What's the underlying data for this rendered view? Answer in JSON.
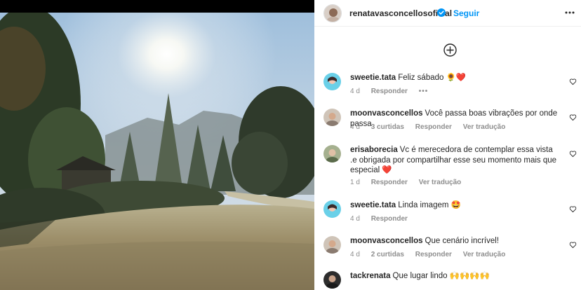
{
  "post": {
    "username": "renatavasconcellosoficial",
    "follow_label": "Seguir",
    "colors": {
      "accent": "#0095f6",
      "heart_red": "#ed4956",
      "text": "#262626",
      "muted": "#8e8e8e"
    }
  },
  "comments": [
    {
      "user": "sweetie.tata",
      "text": "Feliz sábado 🌻❤️",
      "time": "4 d",
      "likes": "",
      "reply": "Responder",
      "translate": "",
      "extra": "•••"
    },
    {
      "user": "moonvasconcellos",
      "text": "Você passa boas vibrações por onde passa",
      "time": "4 d",
      "likes": "3 curtidas",
      "reply": "Responder",
      "translate": "Ver tradução",
      "extra": ""
    },
    {
      "user": "erisaborecia",
      "text": "Vc é merecedora de contemplar essa vista .e obrigada por compartilhar esse seu momento mais que especial ❤️",
      "time": "1 d",
      "likes": "",
      "reply": "Responder",
      "translate": "Ver tradução",
      "extra": ""
    },
    {
      "user": "sweetie.tata",
      "text": "Linda imagem 🤩",
      "time": "4 d",
      "likes": "",
      "reply": "Responder",
      "translate": "",
      "extra": ""
    },
    {
      "user": "moonvasconcellos",
      "text": "Que cenário incrível!",
      "time": "4 d",
      "likes": "2 curtidas",
      "reply": "Responder",
      "translate": "Ver tradução",
      "extra": ""
    },
    {
      "user": "tackrenata",
      "text": "Que lugar lindo 🙌🙌🙌🙌",
      "time": "",
      "likes": "",
      "reply": "",
      "translate": "",
      "extra": ""
    }
  ],
  "icons": {
    "verified": "verified-badge-icon",
    "more": "more-options-icon",
    "add": "add-comment-plus-icon",
    "like": "heart-outline-icon"
  }
}
